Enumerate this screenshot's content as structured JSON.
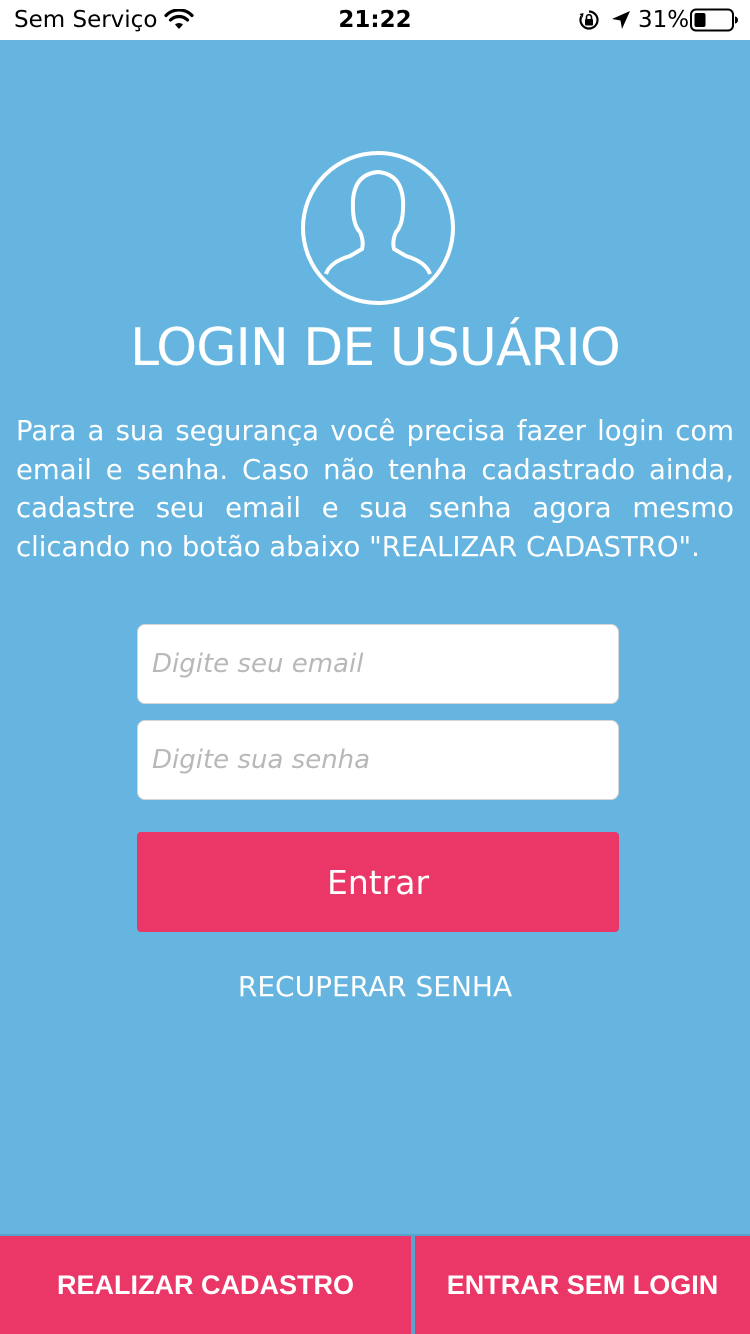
{
  "status": {
    "carrier": "Sem Serviço",
    "time": "21:22",
    "battery": "31%"
  },
  "icons": [
    "wifi-icon",
    "orientation-lock-icon",
    "location-arrow-icon",
    "battery-icon",
    "user-avatar-icon"
  ],
  "colors": {
    "background": "#66b5e0",
    "accent": "#eb3767",
    "text": "#ffffff"
  },
  "login": {
    "title": "LOGIN DE USUÁRIO",
    "description": "Para a sua segurança você precisa fazer login com email e senha. Caso não tenha cadastrado ainda, cadastre seu email e sua senha agora mesmo clicando no botão abaixo \"REALIZAR CADASTRO\".",
    "email_placeholder": "Digite seu email",
    "email_value": "",
    "password_placeholder": "Digite sua senha",
    "password_value": "",
    "submit_label": "Entrar",
    "recover_label": "RECUPERAR SENHA"
  },
  "footer": {
    "register_label": "REALIZAR CADASTRO",
    "guest_label": "ENTRAR SEM LOGIN"
  }
}
